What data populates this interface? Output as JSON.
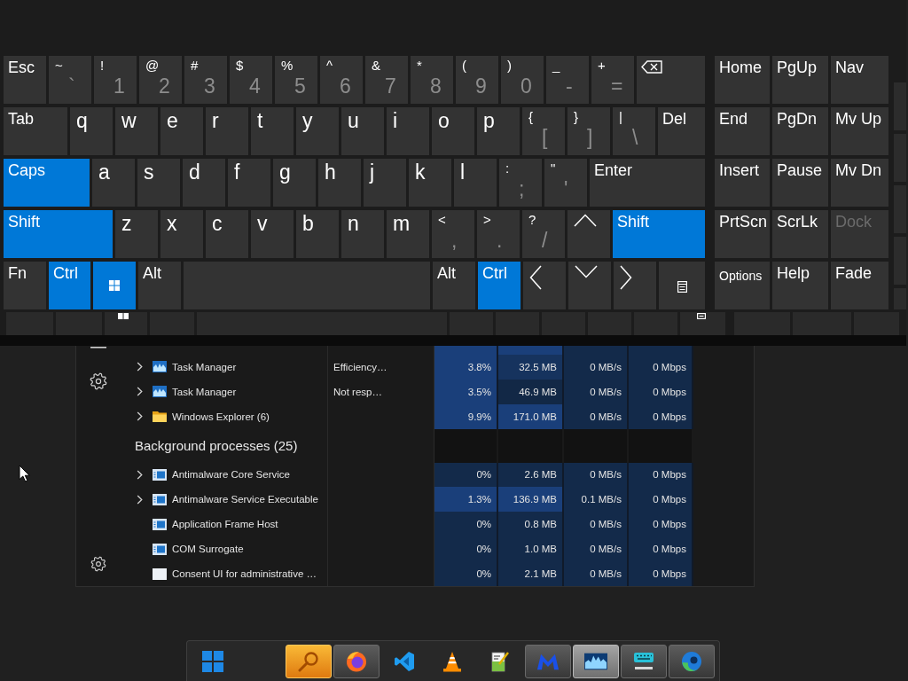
{
  "keyboard": {
    "rows": [
      [
        {
          "kind": "word",
          "label": "Esc",
          "pressed": false
        },
        {
          "kind": "dual",
          "upper": "~",
          "lower": "`",
          "pressed": false
        },
        {
          "kind": "dual",
          "upper": "!",
          "lower": "1",
          "pressed": false
        },
        {
          "kind": "dual",
          "upper": "@",
          "lower": "2",
          "pressed": false
        },
        {
          "kind": "dual",
          "upper": "#",
          "lower": "3",
          "pressed": false
        },
        {
          "kind": "dual",
          "upper": "$",
          "lower": "4",
          "pressed": false
        },
        {
          "kind": "dual",
          "upper": "%",
          "lower": "5",
          "pressed": false
        },
        {
          "kind": "dual",
          "upper": "^",
          "lower": "6",
          "pressed": false
        },
        {
          "kind": "dual",
          "upper": "&",
          "lower": "7",
          "pressed": false
        },
        {
          "kind": "dual",
          "upper": "*",
          "lower": "8",
          "pressed": false
        },
        {
          "kind": "dual",
          "upper": "(",
          "lower": "9",
          "pressed": false
        },
        {
          "kind": "dual",
          "upper": ")",
          "lower": "0",
          "pressed": false
        },
        {
          "kind": "dual",
          "upper": "_",
          "lower": "-",
          "pressed": false
        },
        {
          "kind": "dual",
          "upper": "+",
          "lower": "=",
          "pressed": false
        },
        {
          "kind": "backspace",
          "pressed": false
        }
      ],
      [
        {
          "kind": "word",
          "label": "Tab",
          "pressed": false
        },
        {
          "kind": "letter",
          "label": "q",
          "pressed": false
        },
        {
          "kind": "letter",
          "label": "w",
          "pressed": false
        },
        {
          "kind": "letter",
          "label": "e",
          "pressed": false
        },
        {
          "kind": "letter",
          "label": "r",
          "pressed": false
        },
        {
          "kind": "letter",
          "label": "t",
          "pressed": false
        },
        {
          "kind": "letter",
          "label": "y",
          "pressed": false
        },
        {
          "kind": "letter",
          "label": "u",
          "pressed": false
        },
        {
          "kind": "letter",
          "label": "i",
          "pressed": false
        },
        {
          "kind": "letter",
          "label": "o",
          "pressed": false
        },
        {
          "kind": "letter",
          "label": "p",
          "pressed": false
        },
        {
          "kind": "dual",
          "upper": "{",
          "lower": "[",
          "pressed": false
        },
        {
          "kind": "dual",
          "upper": "}",
          "lower": "]",
          "pressed": false
        },
        {
          "kind": "dual",
          "upper": "|",
          "lower": "\\",
          "pressed": false
        },
        {
          "kind": "word",
          "label": "Del",
          "pressed": false
        }
      ],
      [
        {
          "kind": "word",
          "label": "Caps",
          "pressed": true
        },
        {
          "kind": "letter",
          "label": "a",
          "pressed": false
        },
        {
          "kind": "letter",
          "label": "s",
          "pressed": false
        },
        {
          "kind": "letter",
          "label": "d",
          "pressed": false
        },
        {
          "kind": "letter",
          "label": "f",
          "pressed": false
        },
        {
          "kind": "letter",
          "label": "g",
          "pressed": false
        },
        {
          "kind": "letter",
          "label": "h",
          "pressed": false
        },
        {
          "kind": "letter",
          "label": "j",
          "pressed": false
        },
        {
          "kind": "letter",
          "label": "k",
          "pressed": false
        },
        {
          "kind": "letter",
          "label": "l",
          "pressed": false
        },
        {
          "kind": "dual",
          "upper": ":",
          "lower": ";",
          "pressed": false
        },
        {
          "kind": "dual",
          "upper": "\"",
          "lower": "'",
          "pressed": false
        },
        {
          "kind": "word",
          "label": "Enter",
          "pressed": false
        }
      ],
      [
        {
          "kind": "word",
          "label": "Shift",
          "pressed": true
        },
        {
          "kind": "letter",
          "label": "z",
          "pressed": false
        },
        {
          "kind": "letter",
          "label": "x",
          "pressed": false
        },
        {
          "kind": "letter",
          "label": "c",
          "pressed": false
        },
        {
          "kind": "letter",
          "label": "v",
          "pressed": false
        },
        {
          "kind": "letter",
          "label": "b",
          "pressed": false
        },
        {
          "kind": "letter",
          "label": "n",
          "pressed": false
        },
        {
          "kind": "letter",
          "label": "m",
          "pressed": false
        },
        {
          "kind": "dual",
          "upper": "<",
          "lower": ",",
          "pressed": false
        },
        {
          "kind": "dual",
          "upper": ">",
          "lower": ".",
          "pressed": false
        },
        {
          "kind": "dual",
          "upper": "?",
          "lower": "/",
          "pressed": false
        },
        {
          "kind": "up",
          "pressed": false
        },
        {
          "kind": "word",
          "label": "Shift",
          "pressed": true
        }
      ],
      [
        {
          "kind": "word",
          "label": "Fn",
          "pressed": false
        },
        {
          "kind": "word",
          "label": "Ctrl",
          "pressed": true
        },
        {
          "kind": "windows",
          "pressed": true
        },
        {
          "kind": "word",
          "label": "Alt",
          "pressed": false
        },
        {
          "kind": "space",
          "pressed": false
        },
        {
          "kind": "word",
          "label": "Alt",
          "pressed": false
        },
        {
          "kind": "word",
          "label": "Ctrl",
          "pressed": true
        },
        {
          "kind": "left",
          "pressed": false
        },
        {
          "kind": "down",
          "pressed": false
        },
        {
          "kind": "right",
          "pressed": false
        },
        {
          "kind": "menu",
          "pressed": false
        }
      ]
    ],
    "nav_keys": [
      {
        "kind": "word",
        "label": "Home",
        "disabled": false
      },
      {
        "kind": "word",
        "label": "PgUp",
        "disabled": false
      },
      {
        "kind": "word",
        "label": "Nav",
        "disabled": false
      },
      {
        "kind": "word",
        "label": "End",
        "disabled": false
      },
      {
        "kind": "word",
        "label": "PgDn",
        "disabled": false
      },
      {
        "kind": "word",
        "label": "Mv Up",
        "disabled": false
      },
      {
        "kind": "word",
        "label": "Insert",
        "disabled": false
      },
      {
        "kind": "word",
        "label": "Pause",
        "disabled": false
      },
      {
        "kind": "word",
        "label": "Mv Dn",
        "disabled": false
      },
      {
        "kind": "word",
        "label": "PrtScn",
        "disabled": false
      },
      {
        "kind": "word",
        "label": "ScrLk",
        "disabled": false
      },
      {
        "kind": "word",
        "label": "Dock",
        "disabled": true
      },
      {
        "kind": "caption",
        "label": "Options",
        "disabled": false
      },
      {
        "kind": "word",
        "label": "Help",
        "disabled": false
      },
      {
        "kind": "word",
        "label": "Fade",
        "disabled": false
      }
    ]
  },
  "task_manager": {
    "rows": [
      {
        "kind": "cut",
        "cells": [
          {
            "color": "#1a3f7a"
          },
          {
            "color": "#1a3f7a"
          },
          {
            "color": "#132a4a"
          },
          {
            "color": "#132a4a"
          }
        ]
      },
      {
        "kind": "chart-app",
        "expandable": true,
        "name": "Task Manager",
        "status": "Efficiency…",
        "cells": [
          {
            "value": "3.8%",
            "color": "#1a3f7a"
          },
          {
            "value": "32.5 MB",
            "color": "#16335e"
          },
          {
            "value": "0 MB/s",
            "color": "#132a4a"
          },
          {
            "value": "0 Mbps",
            "color": "#132a4a"
          }
        ]
      },
      {
        "kind": "chart-app",
        "expandable": true,
        "name": "Task Manager",
        "status": "Not resp…",
        "cells": [
          {
            "value": "3.5%",
            "color": "#1a3f7a"
          },
          {
            "value": "46.9 MB",
            "color": "#122846"
          },
          {
            "value": "0 MB/s",
            "color": "#132a4a"
          },
          {
            "value": "0 Mbps",
            "color": "#132a4a"
          }
        ]
      },
      {
        "kind": "folder",
        "expandable": true,
        "name": "Windows Explorer (6)",
        "cells": [
          {
            "value": "9.9%",
            "color": "#1a3f7a"
          },
          {
            "value": "171.0 MB",
            "color": "#1a3f7a"
          },
          {
            "value": "0 MB/s",
            "color": "#132a4a"
          },
          {
            "value": "0 Mbps",
            "color": "#132a4a"
          }
        ]
      },
      {
        "kind": "group",
        "title": "Background processes (25)"
      },
      {
        "kind": "service",
        "expandable": true,
        "name": "Antimalware Core Service",
        "cells": [
          {
            "value": "0%",
            "color": "#132a4a"
          },
          {
            "value": "2.6 MB",
            "color": "#132a4a"
          },
          {
            "value": "0 MB/s",
            "color": "#132a4a"
          },
          {
            "value": "0 Mbps",
            "color": "#132a4a"
          }
        ]
      },
      {
        "kind": "service",
        "expandable": true,
        "name": "Antimalware Service Executable",
        "cells": [
          {
            "value": "1.3%",
            "color": "#1a3f7a"
          },
          {
            "value": "136.9 MB",
            "color": "#1a3f7a"
          },
          {
            "value": "0.1 MB/s",
            "color": "#132a4a"
          },
          {
            "value": "0 Mbps",
            "color": "#132a4a"
          }
        ]
      },
      {
        "kind": "service",
        "expandable": false,
        "name": "Application Frame Host",
        "cells": [
          {
            "value": "0%",
            "color": "#132a4a"
          },
          {
            "value": "0.8 MB",
            "color": "#132a4a"
          },
          {
            "value": "0 MB/s",
            "color": "#132a4a"
          },
          {
            "value": "0 Mbps",
            "color": "#132a4a"
          }
        ]
      },
      {
        "kind": "service",
        "expandable": false,
        "name": "COM Surrogate",
        "cells": [
          {
            "value": "0%",
            "color": "#132a4a"
          },
          {
            "value": "1.0 MB",
            "color": "#132a4a"
          },
          {
            "value": "0 MB/s",
            "color": "#132a4a"
          },
          {
            "value": "0 Mbps",
            "color": "#132a4a"
          }
        ]
      },
      {
        "kind": "blank-window",
        "expandable": false,
        "name": "Consent UI for administrative …",
        "cells": [
          {
            "value": "0%",
            "color": "#132a4a"
          },
          {
            "value": "2.1 MB",
            "color": "#132a4a"
          },
          {
            "value": "0 MB/s",
            "color": "#132a4a"
          },
          {
            "value": "0 Mbps",
            "color": "#132a4a"
          }
        ]
      }
    ]
  },
  "taskbar": {
    "items": [
      {
        "kind": "start",
        "running": false,
        "selected": false,
        "flashing": false
      },
      {
        "kind": "magnifier",
        "running": true,
        "selected": false,
        "flashing": true
      },
      {
        "kind": "ring",
        "running": true,
        "selected": false,
        "flashing": false
      },
      {
        "kind": "ribbon",
        "running": false,
        "selected": false,
        "flashing": false
      },
      {
        "kind": "cone",
        "running": false,
        "selected": false,
        "flashing": false
      },
      {
        "kind": "document",
        "running": false,
        "selected": false,
        "flashing": false
      },
      {
        "kind": "m-logo",
        "running": true,
        "selected": false,
        "flashing": false
      },
      {
        "kind": "chart",
        "running": true,
        "selected": true,
        "flashing": false
      },
      {
        "kind": "keyboard",
        "running": true,
        "selected": false,
        "flashing": false
      },
      {
        "kind": "swirl",
        "running": true,
        "selected": false,
        "flashing": false
      }
    ]
  }
}
